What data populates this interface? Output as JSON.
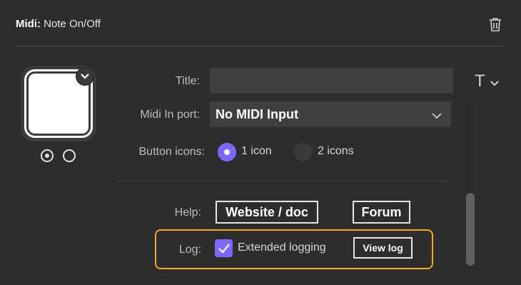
{
  "header": {
    "title_prefix": "Midi:",
    "title_action": "Note On/Off",
    "delete_icon": "trash-icon"
  },
  "preview": {
    "expand_icon": "chevron-down-icon",
    "states": [
      {
        "selected": true
      },
      {
        "selected": false
      }
    ]
  },
  "form": {
    "title_label": "Title:",
    "title_value": "",
    "text_style_glyph": "T",
    "midi_label": "Midi In port:",
    "midi_value": "No MIDI Input",
    "icons_label": "Button icons:",
    "icons_options": [
      {
        "label": "1 icon",
        "selected": true
      },
      {
        "label": "2 icons",
        "selected": false
      }
    ],
    "help_label": "Help:",
    "website_button": "Website / doc",
    "forum_button": "Forum",
    "log_label": "Log:",
    "extended_logging_label": "Extended logging",
    "extended_logging_checked": true,
    "view_log_button": "View log"
  },
  "colors": {
    "background": "#2d2d2d",
    "accent": "#7a68ff",
    "highlight": "#f4a925",
    "field": "#3f3f3f"
  }
}
